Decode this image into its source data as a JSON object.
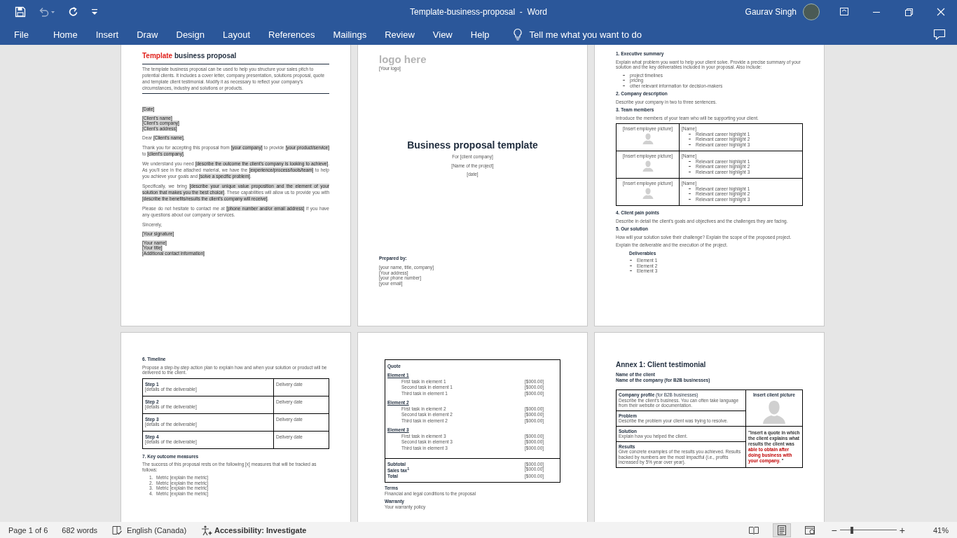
{
  "title_bar": {
    "quick_access": [
      {
        "kind": "save",
        "disabled": false
      },
      {
        "kind": "undo",
        "disabled": true
      },
      {
        "kind": "redo",
        "disabled": false
      },
      {
        "kind": "customize",
        "disabled": false
      }
    ],
    "title": "Template-business-proposal  -  Word",
    "user": "Gaurav Singh"
  },
  "ribbon": {
    "tabs": [
      {
        "label": "File",
        "selected": false
      },
      {
        "label": "Home",
        "selected": false
      },
      {
        "label": "Insert",
        "selected": false
      },
      {
        "label": "Draw",
        "selected": false
      },
      {
        "label": "Design",
        "selected": false
      },
      {
        "label": "Layout",
        "selected": false
      },
      {
        "label": "References",
        "selected": false
      },
      {
        "label": "Mailings",
        "selected": false
      },
      {
        "label": "Review",
        "selected": false
      },
      {
        "label": "View",
        "selected": false
      },
      {
        "label": "Help",
        "selected": false
      }
    ],
    "tell_me": "Tell me what you want to do"
  },
  "pages": [
    {
      "kind": "letter",
      "blocks": [
        {
          "kind": "title",
          "runs": [
            {
              "t": "Template",
              "accent": true
            },
            {
              "t": " business proposal",
              "accent": false
            }
          ]
        },
        {
          "kind": "intro",
          "text": "The template business proposal can be used to help you structure your sales pitch to potential clients. It includes a cover letter, company presentation, solutions proposal, quote and template client testimonial. Modify it as necessary to reflect your company's circumstances, industry and solutions or products."
        },
        {
          "kind": "lines",
          "hl": true,
          "lines": [
            "[Date]"
          ]
        },
        {
          "kind": "lines",
          "hl": true,
          "lines": [
            "[Client's name]",
            "[Client's company]",
            "[Client's address]"
          ]
        },
        {
          "kind": "para",
          "runs": [
            {
              "t": "Dear ",
              "hl": false
            },
            {
              "t": "[Client's name]",
              "hl": true
            },
            {
              "t": ",",
              "hl": false
            }
          ]
        },
        {
          "kind": "para",
          "runs": [
            {
              "t": "Thank you for accepting this proposal from ",
              "hl": false
            },
            {
              "t": "[your company]",
              "hl": true
            },
            {
              "t": " to provide ",
              "hl": false
            },
            {
              "t": "[your product/service]",
              "hl": true
            },
            {
              "t": " to ",
              "hl": false
            },
            {
              "t": "[client's company]",
              "hl": true
            },
            {
              "t": ".",
              "hl": false
            }
          ]
        },
        {
          "kind": "para",
          "runs": [
            {
              "t": "We understand you need ",
              "hl": false
            },
            {
              "t": "[describe the outcome the client's company is looking to achieve]",
              "hl": true
            },
            {
              "t": ". As you'll see in the attached material, we have the ",
              "hl": false
            },
            {
              "t": "[experience/process/tools/team]",
              "hl": true
            },
            {
              "t": " to help you achieve your goals and ",
              "hl": false
            },
            {
              "t": "[solve a specific problem]",
              "hl": true
            },
            {
              "t": ".",
              "hl": false
            }
          ]
        },
        {
          "kind": "para",
          "runs": [
            {
              "t": "Specifically, we bring ",
              "hl": false
            },
            {
              "t": "[describe your unique value proposition and the element of your solution that makes you the best choice]",
              "hl": true
            },
            {
              "t": ". These capabilities will allow us to provide you with ",
              "hl": false
            },
            {
              "t": "[describe the benefits/results the client's company will receive]",
              "hl": true
            },
            {
              "t": ".",
              "hl": false
            }
          ]
        },
        {
          "kind": "para",
          "runs": [
            {
              "t": "Please do not hesitate to contact me at ",
              "hl": false
            },
            {
              "t": "[phone number and/or email address]",
              "hl": true
            },
            {
              "t": " if you have any questions about our company or services.",
              "hl": false
            }
          ]
        },
        {
          "kind": "para",
          "text": "Sincerely,"
        },
        {
          "kind": "lines",
          "hl": true,
          "lines": [
            "[Your signature]"
          ]
        },
        {
          "kind": "lines",
          "hl": true,
          "lines": [
            "[Your name]",
            "[Your title]",
            "[Additional contact information]"
          ]
        }
      ]
    },
    {
      "kind": "cover",
      "blocks": [
        {
          "kind": "logo",
          "text": "logo here"
        },
        {
          "kind": "caption",
          "text": "[Your logo]"
        },
        {
          "kind": "cover_title",
          "text": "Business proposal template"
        },
        {
          "kind": "center",
          "text": "For [client company]"
        },
        {
          "kind": "center",
          "text": "[Name of the project]"
        },
        {
          "kind": "center",
          "text": "[date]"
        },
        {
          "kind": "label",
          "text": "Prepared by:"
        },
        {
          "kind": "lines",
          "hl": false,
          "lines": [
            "[your name, title, company]",
            "[Your address]",
            "[your phone number]",
            "[your email]"
          ]
        }
      ]
    },
    {
      "kind": "body",
      "blocks": [
        {
          "kind": "heading",
          "text": "1. Executive summary"
        },
        {
          "kind": "para",
          "text": "Explain what problem you want to help your client solve. Provide a precise summary of your solution and the key deliverables included in your proposal. Also include:"
        },
        {
          "kind": "bullets",
          "items": [
            "project timelines",
            "pricing",
            "other relevant information for decision-makers"
          ]
        },
        {
          "kind": "heading",
          "text": "2. Company description"
        },
        {
          "kind": "para",
          "text": "Describe your company in two to three sentences."
        },
        {
          "kind": "heading",
          "text": "3. Team members"
        },
        {
          "kind": "para",
          "text": "Introduce the members of your team who will be supporting your client."
        },
        {
          "kind": "team_table",
          "rows": [
            {
              "picture_label": "[Insert employee picture]",
              "name": "[Name]",
              "highlights": [
                "Relevant career highlight 1",
                "Relevant career highlight 2",
                "Relevant career highlight 3"
              ]
            },
            {
              "picture_label": "[Insert employee picture]",
              "name": "[Name]",
              "highlights": [
                "Relevant career highlight 1",
                "Relevant career highlight 2",
                "Relevant career highlight 3"
              ]
            },
            {
              "picture_label": "[Insert employee picture]",
              "name": "[Name]",
              "highlights": [
                "Relevant career highlight 1",
                "Relevant career highlight 2",
                "Relevant career highlight 3"
              ]
            }
          ]
        },
        {
          "kind": "heading",
          "text": "4. Client pain points"
        },
        {
          "kind": "para",
          "text": "Describe in detail the client's goals and objectives and the challenges they are facing."
        },
        {
          "kind": "heading",
          "text": "5. Our solution"
        },
        {
          "kind": "para",
          "text": "How will your solution solve their challenge? Explain the scope of the proposed project."
        },
        {
          "kind": "para",
          "text": "Explain the deliverable and the execution of the project."
        },
        {
          "kind": "subheading",
          "text": "Deliverables"
        },
        {
          "kind": "sub_bullets",
          "items": [
            "Element 1",
            "Element 2",
            "Element 3"
          ]
        }
      ]
    },
    {
      "kind": "body",
      "blocks": [
        {
          "kind": "heading",
          "text": "6. Timeline"
        },
        {
          "kind": "para",
          "text": "Propose a step-by-step action plan to explain how and when your solution or product will be delivered to the client."
        },
        {
          "kind": "timeline_table",
          "rows": [
            {
              "step": "Step 1",
              "detail": "[details of the deliverable]",
              "date": "Delivery date"
            },
            {
              "step": "Step 2",
              "detail": "[details of the deliverable]",
              "date": "Delivery date"
            },
            {
              "step": "Step 3",
              "detail": "[details of the deliverable]",
              "date": "Delivery date"
            },
            {
              "step": "Step 4",
              "detail": "[details of the deliverable]",
              "date": "Delivery date"
            }
          ]
        },
        {
          "kind": "heading",
          "text": "7. Key outcome measures"
        },
        {
          "kind": "para",
          "text": "The success of this proposal rests on the following [x] measures that will be tracked as follows:"
        },
        {
          "kind": "numbered",
          "items": [
            {
              "num": "1.",
              "text": "Metric [explain the metric]"
            },
            {
              "num": "2.",
              "text": "Metric [explain the metric]"
            },
            {
              "num": "3.",
              "text": "Metric [explain the metric]"
            },
            {
              "num": "4.",
              "text": "Metric [explain the metric]"
            }
          ]
        }
      ]
    },
    {
      "kind": "quote",
      "blocks": [
        {
          "kind": "quote_table",
          "heading": "Quote",
          "groups": [
            {
              "title": "Element 1",
              "tasks": [
                {
                  "name": "First task in element 1",
                  "price": "[$000.00]"
                },
                {
                  "name": "Second task in element 1",
                  "price": "[$000.00]"
                },
                {
                  "name": "Third task in element 1",
                  "price": "[$000.00]"
                }
              ]
            },
            {
              "title": "Element 2",
              "tasks": [
                {
                  "name": "First task in element 2",
                  "price": "[$000.00]"
                },
                {
                  "name": "Second task in element 2",
                  "price": "[$000.00]"
                },
                {
                  "name": "Third task in element 2",
                  "price": "[$000.00]"
                }
              ]
            },
            {
              "title": "Element 3",
              "tasks": [
                {
                  "name": "First task in element 3",
                  "price": "[$000.00]"
                },
                {
                  "name": "Second task in element 3",
                  "price": "[$000.00]"
                },
                {
                  "name": "Third task in element 3",
                  "price": "[$000.00]"
                }
              ]
            }
          ],
          "totals": [
            {
              "label": "Subtotal",
              "price": "[$000.00]"
            },
            {
              "label": "Sales tax$^{1}$",
              "price": "[$000.00]"
            },
            {
              "label": "Total",
              "price": "[$000.00]"
            }
          ]
        },
        {
          "kind": "term",
          "title": "Terms",
          "text": "Financial and legal conditions to the proposal"
        },
        {
          "kind": "term",
          "title": "Warranty",
          "text": "Your warranty policy"
        }
      ]
    },
    {
      "kind": "testimonial",
      "blocks": [
        {
          "kind": "annex_title",
          "text": "Annex 1: Client testimonial"
        },
        {
          "kind": "names",
          "lines": [
            "Name of the client",
            "Name of the company (for B2B businesses)"
          ]
        },
        {
          "kind": "testimonial_table",
          "cells": [
            {
              "title": "**Company profile** (for B2B businesses)",
              "text": "Describe the client's business. You can often take language from their website or documentation."
            },
            {
              "title": "**Problem**",
              "text": "Describe the problem your client was trying to resolve."
            },
            {
              "title": "**Solution**",
              "text": "Explain how you helped the client."
            },
            {
              "title": "**Results**",
              "text": "Give concrete examples of the results you achieved. Results backed by numbers are the most impactful (i.e., profits increased by 5% year over year)."
            }
          ],
          "picture_label": "Insert client picture",
          "quote": [
            {
              "t": "\"Insert a quote in which the client explains what results the client was ",
              "accent": false
            },
            {
              "t": "able to obtain after doing business with your company.",
              "accent": true
            },
            {
              "t": " \"",
              "accent": false
            }
          ]
        }
      ]
    }
  ],
  "status_bar": {
    "page": "Page 1 of 6",
    "words": "682 words",
    "language": "English (Canada)",
    "accessibility": "Accessibility: Investigate",
    "views": [
      {
        "kind": "read",
        "selected": false
      },
      {
        "kind": "print",
        "selected": true
      },
      {
        "kind": "web",
        "selected": false
      }
    ],
    "zoom": {
      "minus": "−",
      "plus": "+",
      "level": 0.21,
      "reading": "41%"
    }
  }
}
